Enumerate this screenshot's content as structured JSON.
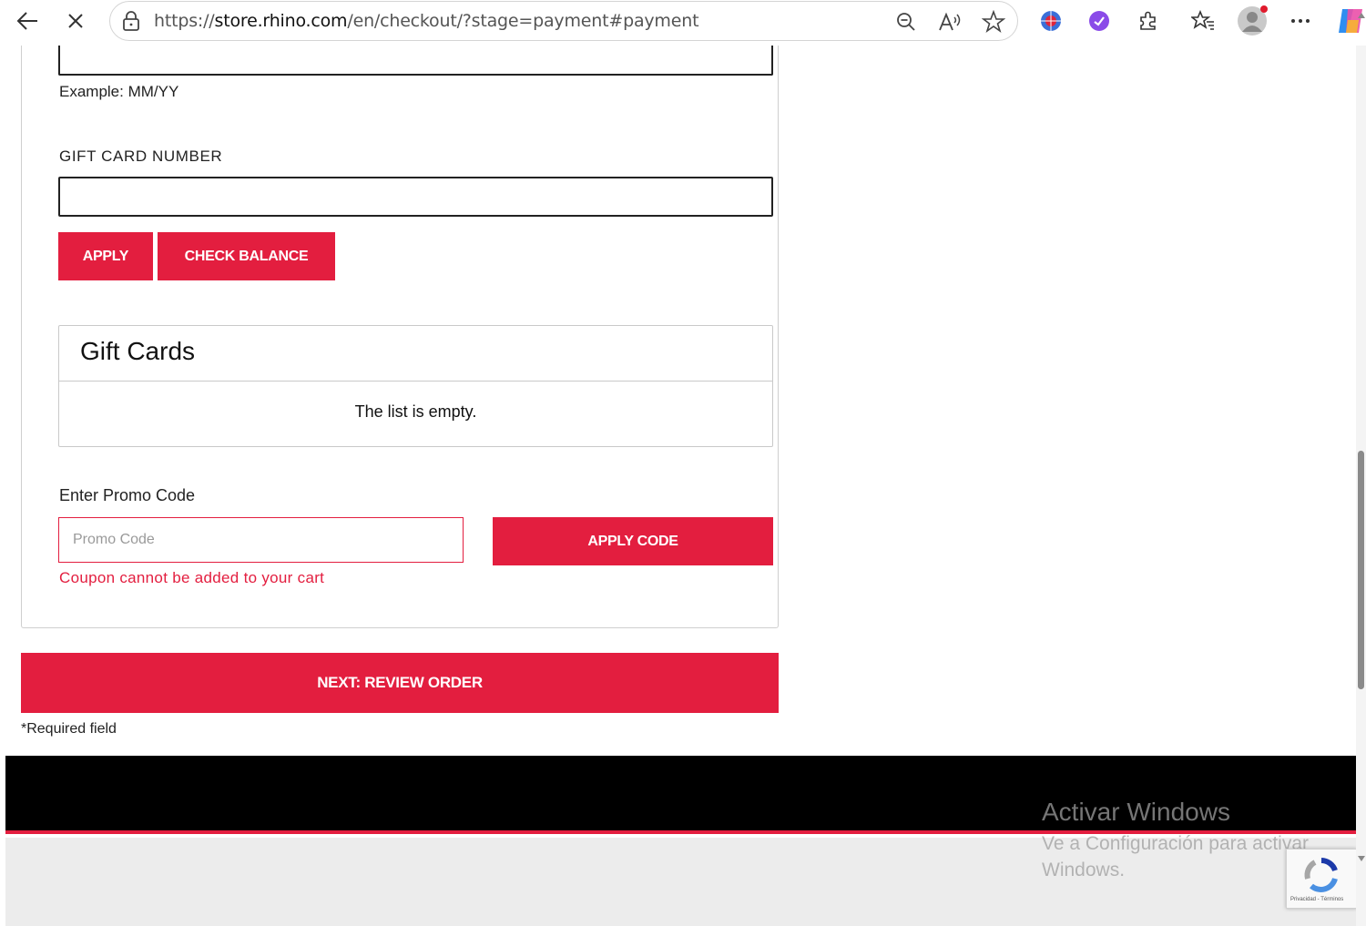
{
  "browser": {
    "url_prefix": "https://",
    "url_host": "store.rhino.com",
    "url_path": "/en/checkout/?stage=payment#payment",
    "icons": [
      "back-arrow-icon",
      "stop-loading-icon",
      "lock-icon",
      "zoom-out-icon",
      "read-aloud-icon",
      "favorite-star-icon",
      "extension-shield-icon",
      "extension-purple-icon",
      "extensions-puzzle-icon",
      "favorites-icon",
      "profile-avatar-icon",
      "more-menu-icon",
      "copilot-icon"
    ]
  },
  "payment": {
    "expiry_hint": "Example: MM/YY",
    "gift_card_label": "GIFT CARD NUMBER",
    "apply_label": "APPLY",
    "check_balance_label": "CHECK BALANCE",
    "gift_cards_title": "Gift Cards",
    "gift_cards_empty": "The list is empty.",
    "promo_label": "Enter Promo Code",
    "promo_placeholder": "Promo Code",
    "apply_code_label": "APPLY CODE",
    "promo_error": "Coupon cannot be added to your cart",
    "next_label": "NEXT: REVIEW ORDER",
    "required_note": "*Required field"
  },
  "overlay": {
    "activate_title": "Activar Windows",
    "activate_sub": "Ve a Configuración para activar Windows.",
    "recaptcha_text": "Privacidad - Términos"
  },
  "colors": {
    "brand_red": "#e31e3f",
    "footer_black": "#000000",
    "footer_grey": "#ececec"
  }
}
